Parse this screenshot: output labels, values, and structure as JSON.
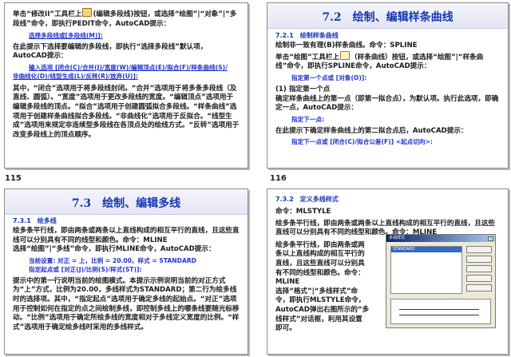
{
  "page_numbers": {
    "left": "115",
    "right": "116"
  },
  "slide1": {
    "p1a": "单击“修改II”工具栏上",
    "p1b": "(编辑多段线)按钮，或选择“绘图”|“对象”|“多段线”命令，即执行PEDIT命令，AutoCAD提示：",
    "prompt1": "选择多段线或[多段线(M)]:",
    "p2": "在此提示下选择要编辑的多段线，即执行“选择多段线”默认项，AutoCAD提示：",
    "prompt2a": "输入选项 [闭合(C)/合并(J)/宽度(W)/编辑顶点(E)/拟合(F)/样条曲线(S)/",
    "prompt2b": "非曲线化(D)/线型生成(L)/反转(R)/放弃(U)]:",
    "p3": "其中，“闭合”选项用于将多段线封闭。“合并”选项用于将多条多段线（及直线、圆弧）。“宽度”选项用于更改多段线的宽度。“编辑顶点”选项用于编辑多段线的顶点。“拟合”选项用于创建圆弧拟合多段线。“样条曲线”选项用于创建样条曲线拟合多段线。“非曲线化”选项用于反拟合。“线型生成”选项用来规定非连续型多段线在各顶点处的绘线方式。“反转”选项用于改变多段线上的顶点顺序。"
  },
  "slide2": {
    "title": "7.2　绘制、编辑样条曲线",
    "subhead": "7.2.1　绘制样条曲线",
    "p1": "绘制非一致有理(B)样条曲线。命令：SPLINE",
    "p2a": "单击“绘图”工具栏上",
    "p2b": "（样条曲线）按钮，或选择“绘图”|“样条曲线”命令，即执行SPLINE命令，AutoCAD提示：",
    "prompt1": "指定第一个点或 [对象(O)]:",
    "h1": "(1) 指定第一个点",
    "p3": "确定样条曲线上的第一点（即第一拟合点），为默认项。执行此选项，即确定一点，AutoCAD提示：",
    "prompt2": "指定下一点:",
    "p4": "在此提示下确定样条曲线上的第二拟合点后，AutoCAD提示：",
    "prompt3": "指定下一点或 [闭合(C)/拟合公差(F)] <起点切向>:"
  },
  "slide3": {
    "title": "7.3　绘制、编辑多线",
    "subhead": "7.3.1　绘多线",
    "p1": "绘多条平行线，即由两条或两条以上直线构成的相互平行的直线，且这些直线可以分别具有不同的线型和颜色。命令：MLINE",
    "p2": "选择“绘图”|“多线”命令，即执行MLINE命令，AutoCAD提示：",
    "prompt1": "当前设置: 对正 = 上，比例 = 20.00，样式 = STANDARD",
    "prompt2": "指定起点或 [对正(J)/比例(S)/样式(ST)]:",
    "p3": "提示中的第一行说明当前的绘图模式。本提示示例说明当前的对正方式为“上”方式，比例为20.00，多线样式为STANDARD；第二行为绘多线时的选择项。其中，“指定起点”选项用于确定多线的起始点。“对正”选项用于控制如何在指定的点之间绘制多线，即控制多线上的哪条线要随光标移动。“比例”选项用于确定所绘多线的宽度相对于多线定义宽度的比例。“样式”选项用于确定绘多线时采用的多线样式。"
  },
  "slide4": {
    "subhead": "7.3.2　定义多线样式",
    "command": "命令：MLSTYLE",
    "p1": "绘多条平行线，即由两条或两条以上直线构成的相互平行的直线，且这些直线可以分别具有不同的线型和颜色。命令：MLINE",
    "p2a": "绘多条平行线，即由两条或两",
    "p2b": "条以上直线构成的相互平行的",
    "p2c": "直线，且这些直线可以分别具",
    "p2d": "有不同的线型和颜色。命令：",
    "p2e": "MLINE",
    "p3a": "选择“格式”|“多线样式”命",
    "p3b": "令，即执行MLSTYLE命令，",
    "p3c": "AutoCAD弹出右图所示的“多",
    "p3d": "线样式”对话框，利用其设置",
    "p3e": "即可。",
    "dialog_title": "多线样式",
    "dialog_item": "STANDARD"
  }
}
